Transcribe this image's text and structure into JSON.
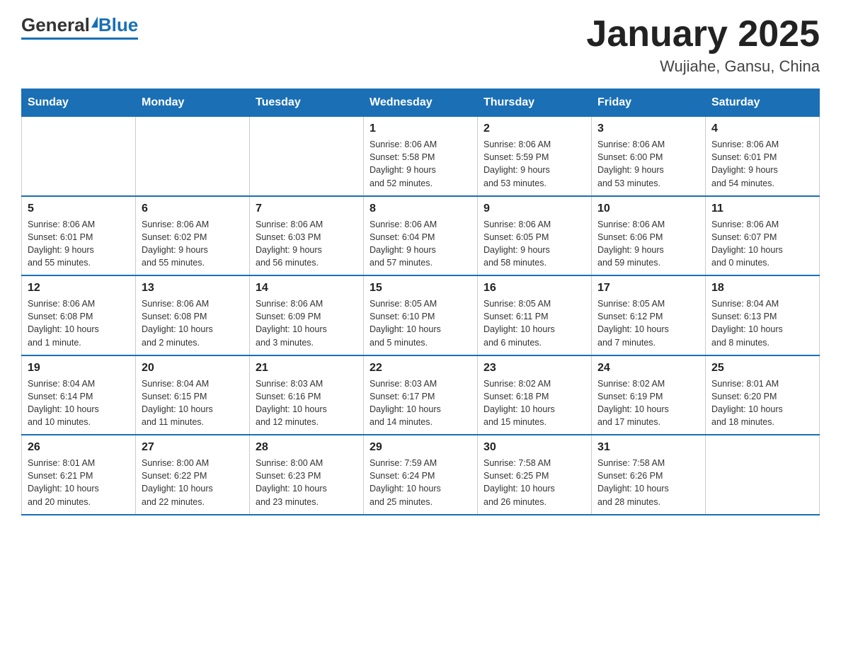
{
  "header": {
    "logo_general": "General",
    "logo_blue": "Blue",
    "title": "January 2025",
    "subtitle": "Wujiahe, Gansu, China"
  },
  "calendar": {
    "days_of_week": [
      "Sunday",
      "Monday",
      "Tuesday",
      "Wednesday",
      "Thursday",
      "Friday",
      "Saturday"
    ],
    "weeks": [
      [
        {
          "day": "",
          "info": ""
        },
        {
          "day": "",
          "info": ""
        },
        {
          "day": "",
          "info": ""
        },
        {
          "day": "1",
          "info": "Sunrise: 8:06 AM\nSunset: 5:58 PM\nDaylight: 9 hours\nand 52 minutes."
        },
        {
          "day": "2",
          "info": "Sunrise: 8:06 AM\nSunset: 5:59 PM\nDaylight: 9 hours\nand 53 minutes."
        },
        {
          "day": "3",
          "info": "Sunrise: 8:06 AM\nSunset: 6:00 PM\nDaylight: 9 hours\nand 53 minutes."
        },
        {
          "day": "4",
          "info": "Sunrise: 8:06 AM\nSunset: 6:01 PM\nDaylight: 9 hours\nand 54 minutes."
        }
      ],
      [
        {
          "day": "5",
          "info": "Sunrise: 8:06 AM\nSunset: 6:01 PM\nDaylight: 9 hours\nand 55 minutes."
        },
        {
          "day": "6",
          "info": "Sunrise: 8:06 AM\nSunset: 6:02 PM\nDaylight: 9 hours\nand 55 minutes."
        },
        {
          "day": "7",
          "info": "Sunrise: 8:06 AM\nSunset: 6:03 PM\nDaylight: 9 hours\nand 56 minutes."
        },
        {
          "day": "8",
          "info": "Sunrise: 8:06 AM\nSunset: 6:04 PM\nDaylight: 9 hours\nand 57 minutes."
        },
        {
          "day": "9",
          "info": "Sunrise: 8:06 AM\nSunset: 6:05 PM\nDaylight: 9 hours\nand 58 minutes."
        },
        {
          "day": "10",
          "info": "Sunrise: 8:06 AM\nSunset: 6:06 PM\nDaylight: 9 hours\nand 59 minutes."
        },
        {
          "day": "11",
          "info": "Sunrise: 8:06 AM\nSunset: 6:07 PM\nDaylight: 10 hours\nand 0 minutes."
        }
      ],
      [
        {
          "day": "12",
          "info": "Sunrise: 8:06 AM\nSunset: 6:08 PM\nDaylight: 10 hours\nand 1 minute."
        },
        {
          "day": "13",
          "info": "Sunrise: 8:06 AM\nSunset: 6:08 PM\nDaylight: 10 hours\nand 2 minutes."
        },
        {
          "day": "14",
          "info": "Sunrise: 8:06 AM\nSunset: 6:09 PM\nDaylight: 10 hours\nand 3 minutes."
        },
        {
          "day": "15",
          "info": "Sunrise: 8:05 AM\nSunset: 6:10 PM\nDaylight: 10 hours\nand 5 minutes."
        },
        {
          "day": "16",
          "info": "Sunrise: 8:05 AM\nSunset: 6:11 PM\nDaylight: 10 hours\nand 6 minutes."
        },
        {
          "day": "17",
          "info": "Sunrise: 8:05 AM\nSunset: 6:12 PM\nDaylight: 10 hours\nand 7 minutes."
        },
        {
          "day": "18",
          "info": "Sunrise: 8:04 AM\nSunset: 6:13 PM\nDaylight: 10 hours\nand 8 minutes."
        }
      ],
      [
        {
          "day": "19",
          "info": "Sunrise: 8:04 AM\nSunset: 6:14 PM\nDaylight: 10 hours\nand 10 minutes."
        },
        {
          "day": "20",
          "info": "Sunrise: 8:04 AM\nSunset: 6:15 PM\nDaylight: 10 hours\nand 11 minutes."
        },
        {
          "day": "21",
          "info": "Sunrise: 8:03 AM\nSunset: 6:16 PM\nDaylight: 10 hours\nand 12 minutes."
        },
        {
          "day": "22",
          "info": "Sunrise: 8:03 AM\nSunset: 6:17 PM\nDaylight: 10 hours\nand 14 minutes."
        },
        {
          "day": "23",
          "info": "Sunrise: 8:02 AM\nSunset: 6:18 PM\nDaylight: 10 hours\nand 15 minutes."
        },
        {
          "day": "24",
          "info": "Sunrise: 8:02 AM\nSunset: 6:19 PM\nDaylight: 10 hours\nand 17 minutes."
        },
        {
          "day": "25",
          "info": "Sunrise: 8:01 AM\nSunset: 6:20 PM\nDaylight: 10 hours\nand 18 minutes."
        }
      ],
      [
        {
          "day": "26",
          "info": "Sunrise: 8:01 AM\nSunset: 6:21 PM\nDaylight: 10 hours\nand 20 minutes."
        },
        {
          "day": "27",
          "info": "Sunrise: 8:00 AM\nSunset: 6:22 PM\nDaylight: 10 hours\nand 22 minutes."
        },
        {
          "day": "28",
          "info": "Sunrise: 8:00 AM\nSunset: 6:23 PM\nDaylight: 10 hours\nand 23 minutes."
        },
        {
          "day": "29",
          "info": "Sunrise: 7:59 AM\nSunset: 6:24 PM\nDaylight: 10 hours\nand 25 minutes."
        },
        {
          "day": "30",
          "info": "Sunrise: 7:58 AM\nSunset: 6:25 PM\nDaylight: 10 hours\nand 26 minutes."
        },
        {
          "day": "31",
          "info": "Sunrise: 7:58 AM\nSunset: 6:26 PM\nDaylight: 10 hours\nand 28 minutes."
        },
        {
          "day": "",
          "info": ""
        }
      ]
    ]
  }
}
